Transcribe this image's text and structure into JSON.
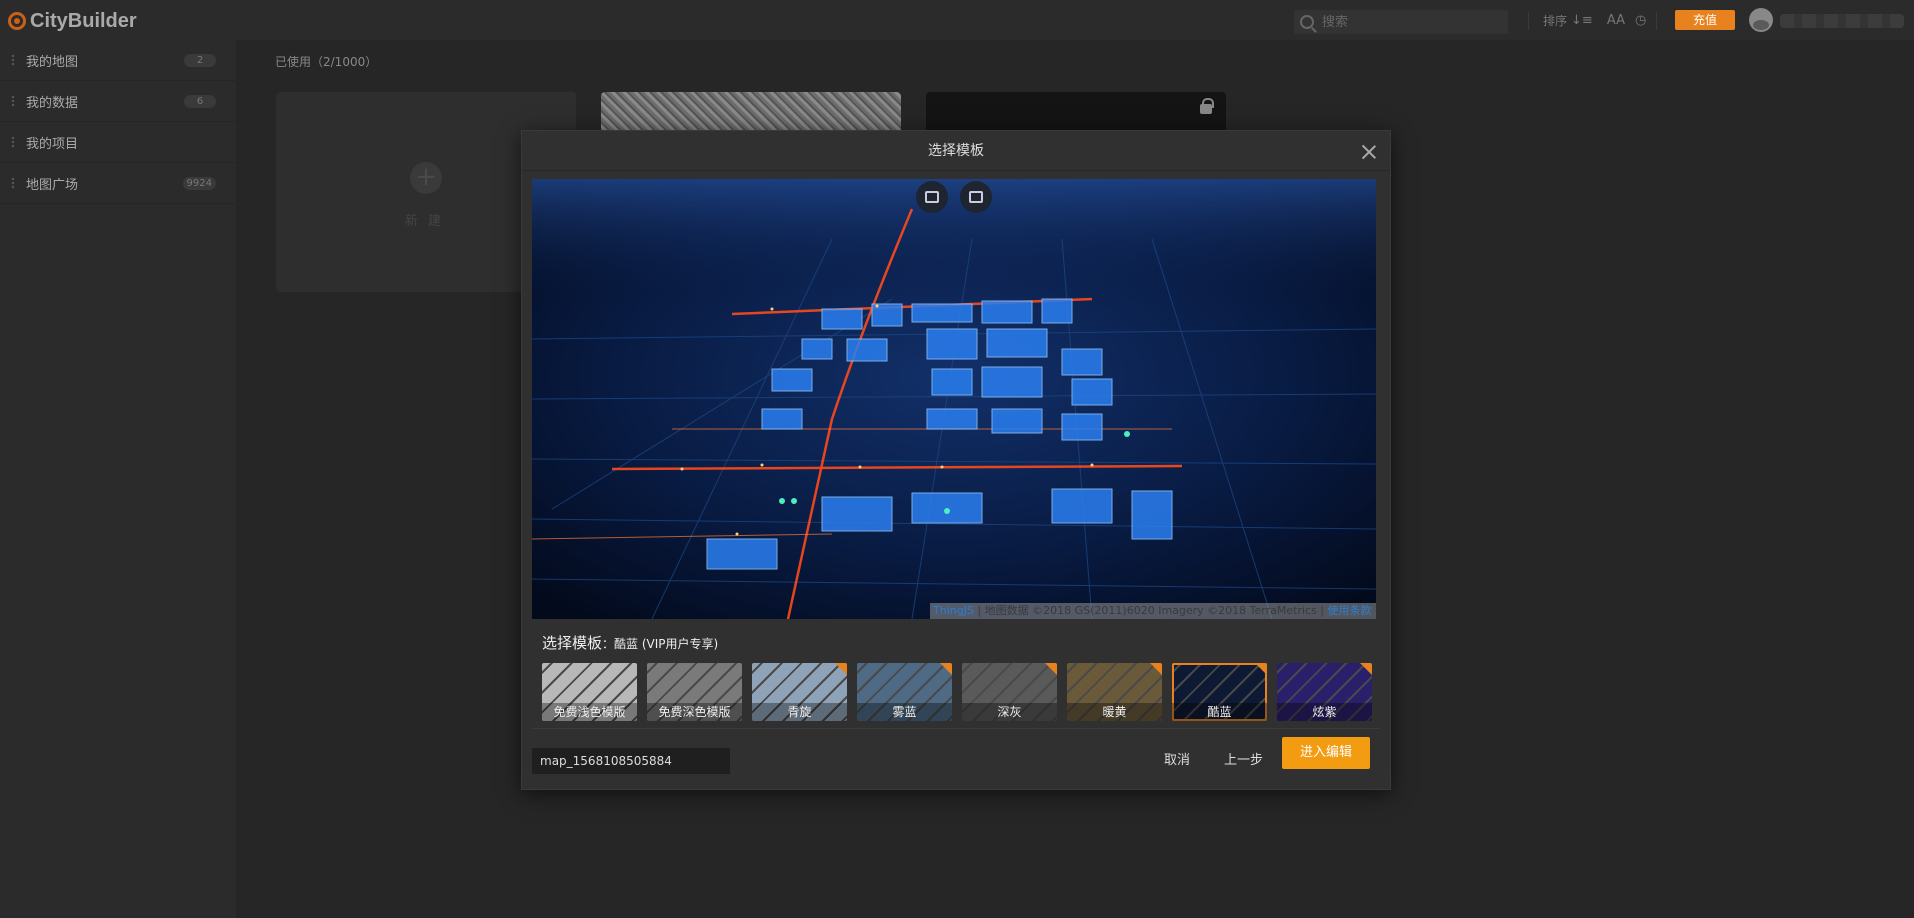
{
  "app": {
    "logo_text": "CityBuilder"
  },
  "header": {
    "search_placeholder": "搜索",
    "sort_label": "排序",
    "charge_label": "充值"
  },
  "sidebar": {
    "items": [
      {
        "label": "我的地图",
        "count": "2"
      },
      {
        "label": "我的数据",
        "count": "6"
      },
      {
        "label": "我的项目",
        "count": ""
      },
      {
        "label": "地图广场",
        "count": "9924"
      }
    ]
  },
  "main": {
    "used_label": "已使用（2/1000）",
    "new_card_label": "新建"
  },
  "modal": {
    "title": "选择模板",
    "attribution": {
      "brand": "ThingJS",
      "text": " | 地图数据 ©2018 GS(2011)6020 Imagery ©2018 TerraMetrics | ",
      "terms": "使用条款"
    },
    "template_header": "选择模板",
    "template_sub": "：酷蓝 (VIP用户专享)",
    "templates": [
      {
        "label": "免费浅色模版",
        "vip": false,
        "selected": false,
        "color": "#b8b8b8"
      },
      {
        "label": "免费深色模版",
        "vip": false,
        "selected": false,
        "color": "#7a7a7a"
      },
      {
        "label": "青旋",
        "vip": true,
        "selected": false,
        "color": "#8fa3b8"
      },
      {
        "label": "雾蓝",
        "vip": true,
        "selected": false,
        "color": "#4e6a85"
      },
      {
        "label": "深灰",
        "vip": true,
        "selected": false,
        "color": "#5a5a5a"
      },
      {
        "label": "暖黄",
        "vip": true,
        "selected": false,
        "color": "#6b5a3a"
      },
      {
        "label": "酷蓝",
        "vip": true,
        "selected": true,
        "color": "#0e1a33"
      },
      {
        "label": "炫紫",
        "vip": true,
        "selected": false,
        "color": "#2a1f6a"
      }
    ],
    "map_name_value": "map_1568108505884",
    "cancel_label": "取消",
    "back_label": "上一步",
    "enter_label": "进入编辑"
  }
}
